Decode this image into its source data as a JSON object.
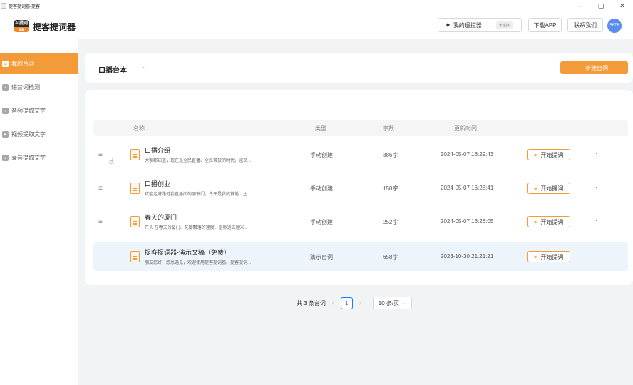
{
  "window": {
    "title": "提客提词器-提客",
    "controls": [
      "–",
      "▢",
      "✕"
    ]
  },
  "header": {
    "app_name": "提客提词器",
    "logo_text": "AI提词",
    "logo_sub": "提客",
    "remote_label": "我的遥控器",
    "remote_badge": "未连接",
    "download_label": "下载APP",
    "contact_label": "联系我们",
    "avatar_text": "5678"
  },
  "sidebar": {
    "items": [
      {
        "label": "我的台词",
        "active": true
      },
      {
        "label": "违禁词检测",
        "active": false
      },
      {
        "label": "音频提取文字",
        "active": false
      },
      {
        "label": "视频提取文字",
        "active": false
      },
      {
        "label": "录音提取文字",
        "active": false
      }
    ]
  },
  "main": {
    "title": "口播台本",
    "new_button": "+ 新建台词",
    "columns": {
      "name": "名称",
      "type": "类型",
      "count": "字数",
      "updated": "更新时间"
    },
    "rows": [
      {
        "name": "口播介绍",
        "desc": "大家都知道，现在是全民直播、全民带货的时代。越来...",
        "type": "手动创建",
        "count": "386字",
        "updated": "2024-05-07 16:29:43",
        "action": "开始提词"
      },
      {
        "name": "口播创业",
        "desc": "欢迎走进路过我直播间的朋友们，今天是我的首播，主...",
        "type": "手动创建",
        "count": "150字",
        "updated": "2024-05-07 16:28:41",
        "action": "开始提词"
      },
      {
        "name": "春天的厦门",
        "desc": "开头 在春天的厦门、花瓣飘落的速度、是秒速五厘米...",
        "type": "手动创建",
        "count": "252字",
        "updated": "2024-05-07 16:26:05",
        "action": "开始提词"
      },
      {
        "name": "提客提词器-演示文稿（免费）",
        "desc": "朋友您好，感恩遇见，欢迎使用提客提词器。提客提词...",
        "type": "演示台词",
        "count": "658字",
        "updated": "2023-10-30 21:21:21",
        "action": "开始提词"
      }
    ],
    "pagination": {
      "total_text": "共 3 条台词",
      "current_page": "1",
      "page_size": "10 条/页"
    }
  },
  "colors": {
    "accent": "#f39b38",
    "page_active": "#1677ff",
    "highlight_row": "#eef4fb"
  }
}
